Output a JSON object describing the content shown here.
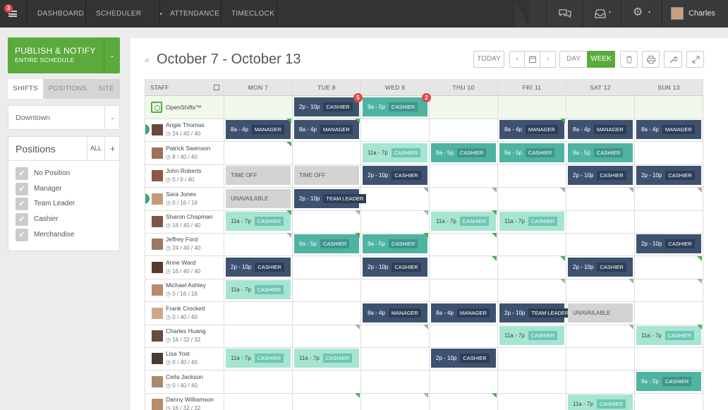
{
  "app": {
    "notifications": "3",
    "user_name": "Charles"
  },
  "nav": {
    "items": [
      "DASHBOARD",
      "SCHEDULER",
      "ATTENDANCE",
      "TIMECLOCK"
    ],
    "caret": "▾"
  },
  "colors": {
    "brand_green": "#5aab3c",
    "shift_dark": "#3e5270",
    "shift_teal": "#4fb3a2",
    "shift_light": "#a6e5d2",
    "shift_gray": "#d3d3d3",
    "topbar": "#333333"
  },
  "icons": {
    "menu": "hamburger-icon",
    "chat": "chat-icon",
    "inbox": "inbox-icon",
    "settings": "gear-icon"
  },
  "sidebar": {
    "publish_line1": "PUBLISH & NOTIFY",
    "publish_line2": "ENTIRE SCHEDULE",
    "publish_caret": "⌄",
    "tabs": [
      "SHIFTS",
      "POSITIONS",
      "SITE"
    ],
    "active_tab": "SHIFTS",
    "location": "Downtown",
    "positions_title": "Positions",
    "positions_all": "ALL",
    "positions_add": "+",
    "positions": [
      "No Position",
      "Manager",
      "Team Leader",
      "Cashier",
      "Merchandise"
    ]
  },
  "toolbar": {
    "back_icon": "«",
    "date_range": "October 7 - October 13",
    "today": "TODAY",
    "prev": "‹",
    "next": "›",
    "day": "DAY",
    "week": "WEEK",
    "active_view": "WEEK"
  },
  "grid": {
    "staff_header": "STAFF",
    "days": [
      "MON 7",
      "TUE 8",
      "WED 9",
      "THU 10",
      "FRI 11",
      "SAT 12",
      "SUN 13"
    ],
    "rows": [
      {
        "name": "OpenShifts™",
        "hours": "",
        "open": true,
        "shifts": [
          null,
          {
            "t": "2p - 10p",
            "r": "CASHIER",
            "c": "dk",
            "n": "5"
          },
          {
            "t": "9a - 5p",
            "r": "CASHIER",
            "c": "tl",
            "n": "2"
          },
          null,
          null,
          null,
          null
        ]
      },
      {
        "name": "Angie Thomas",
        "hours": "24 / 40 / 40",
        "check": true,
        "shifts": [
          {
            "t": "8a - 4p",
            "r": "MANAGER",
            "c": "dk",
            "m": "g"
          },
          {
            "t": "8a - 4p",
            "r": "MANAGER",
            "c": "dk",
            "m": "g"
          },
          null,
          null,
          {
            "t": "8a - 4p",
            "r": "MANAGER",
            "c": "dk",
            "m": "g"
          },
          {
            "t": "8a - 4p",
            "r": "MANAGER",
            "c": "dk"
          },
          {
            "t": "8a - 4p",
            "r": "MANAGER",
            "c": "dk"
          }
        ]
      },
      {
        "name": "Patrick Swenson",
        "hours": "8 / 40 / 40",
        "shifts": [
          {
            "m": "g"
          },
          null,
          {
            "t": "11a - 7p",
            "r": "CASHIER",
            "c": "lt"
          },
          {
            "t": "9a - 5p",
            "r": "CASHIER",
            "c": "tl"
          },
          {
            "t": "9a - 5p",
            "r": "CASHIER",
            "c": "tl"
          },
          {
            "t": "9a - 5p",
            "r": "CASHIER",
            "c": "tl"
          },
          null
        ]
      },
      {
        "name": "John Roberts",
        "hours": "0 / 0 / 40",
        "shifts": [
          {
            "t": "TIME OFF",
            "c": "gy"
          },
          {
            "t": "TIME OFF",
            "c": "gy"
          },
          {
            "t": "2p - 10p",
            "r": "CASHIER",
            "c": "dk"
          },
          null,
          null,
          {
            "t": "2p - 10p",
            "r": "CASHIER",
            "c": "dk"
          },
          {
            "t": "2p - 10p",
            "r": "CASHIER",
            "c": "dk"
          }
        ]
      },
      {
        "name": "Sara Jones",
        "hours": "0 / 16 / 16",
        "check": true,
        "shifts": [
          {
            "t": "UNAVAILABLE",
            "c": "gy"
          },
          {
            "t": "2p - 10p",
            "r": "TEAM LEADER",
            "c": "dk"
          },
          {
            "m": "s"
          },
          {
            "m": "s"
          },
          {
            "m": "s"
          },
          {
            "m": "s"
          },
          {
            "m": "s"
          }
        ]
      },
      {
        "name": "Sharon Chapman",
        "hours": "16 / 40 / 40",
        "shifts": [
          {
            "t": "11a - 7p",
            "r": "CASHIER",
            "c": "lt",
            "m": "g"
          },
          {
            "m": "s"
          },
          {
            "m": "s"
          },
          {
            "t": "11a - 7p",
            "r": "CASHIER",
            "c": "lt",
            "m": "g"
          },
          {
            "t": "11a - 7p",
            "r": "CASHIER",
            "c": "lt"
          },
          null,
          null
        ]
      },
      {
        "name": "Jeffrey Ford",
        "hours": "24 / 40 / 40",
        "shifts": [
          {
            "m": "s"
          },
          {
            "t": "9a - 5p",
            "r": "CASHIER",
            "c": "tl",
            "m": "g"
          },
          {
            "t": "9a - 5p",
            "r": "CASHIER",
            "c": "tl",
            "m": "g"
          },
          {
            "m": "g"
          },
          null,
          null,
          {
            "t": "2p - 10p",
            "r": "CASHIER",
            "c": "dk"
          }
        ]
      },
      {
        "name": "Anne Ward",
        "hours": "16 / 40 / 40",
        "shifts": [
          {
            "t": "2p - 10p",
            "r": "CASHIER",
            "c": "dk"
          },
          null,
          {
            "t": "2p - 10p",
            "r": "CASHIER",
            "c": "dk"
          },
          {
            "m": "g"
          },
          {
            "m": "g"
          },
          {
            "t": "2p - 10p",
            "r": "CASHIER",
            "c": "dk"
          },
          {
            "m": "g"
          }
        ]
      },
      {
        "name": "Michael Ashley",
        "hours": "0 / 16 / 16",
        "shifts": [
          {
            "t": "11a - 7p",
            "r": "CASHIER",
            "c": "lt"
          },
          null,
          null,
          null,
          {
            "m": "s"
          },
          {
            "m": "s"
          },
          {
            "m": "s"
          }
        ]
      },
      {
        "name": "Frank Crockett",
        "hours": "0 / 40 / 40",
        "shifts": [
          null,
          null,
          {
            "t": "8a - 4p",
            "r": "MANAGER",
            "c": "dk"
          },
          {
            "t": "8a - 4p",
            "r": "MANAGER",
            "c": "dk"
          },
          {
            "t": "2p - 10p",
            "r": "TEAM LEADER",
            "c": "dk"
          },
          {
            "t": "UNAVAILABLE",
            "c": "gy"
          },
          null
        ]
      },
      {
        "name": "Charles Huang",
        "hours": "16 / 32 / 32",
        "shifts": [
          null,
          {
            "m": "s"
          },
          {
            "m": "s"
          },
          null,
          {
            "t": "11a - 7p",
            "r": "CASHIER",
            "c": "lt"
          },
          {
            "m": "s"
          },
          {
            "t": "11a - 7p",
            "r": "CASHIER",
            "c": "lt",
            "m": "g"
          }
        ]
      },
      {
        "name": "Lisa Yost",
        "hours": "0 / 40 / 40",
        "shifts": [
          {
            "t": "11a - 7p",
            "r": "CASHIER",
            "c": "lt"
          },
          {
            "t": "11a - 7p",
            "r": "CASHIER",
            "c": "lt"
          },
          null,
          {
            "t": "2p - 10p",
            "r": "CASHIER",
            "c": "dk"
          },
          null,
          null,
          null
        ]
      },
      {
        "name": "Ceila Jackson",
        "hours": "0 / 40 / 40",
        "shifts": [
          null,
          null,
          null,
          null,
          null,
          null,
          {
            "t": "9a - 5p",
            "r": "CASHIER",
            "c": "tl"
          }
        ]
      },
      {
        "name": "Danny  Williamson",
        "hours": "16 / 32 / 32",
        "shifts": [
          null,
          {
            "m": "g"
          },
          {
            "m": "s"
          },
          {
            "m": "g"
          },
          null,
          {
            "t": "11a - 7p",
            "r": "CASHIER",
            "c": "lt"
          },
          null
        ]
      }
    ]
  }
}
